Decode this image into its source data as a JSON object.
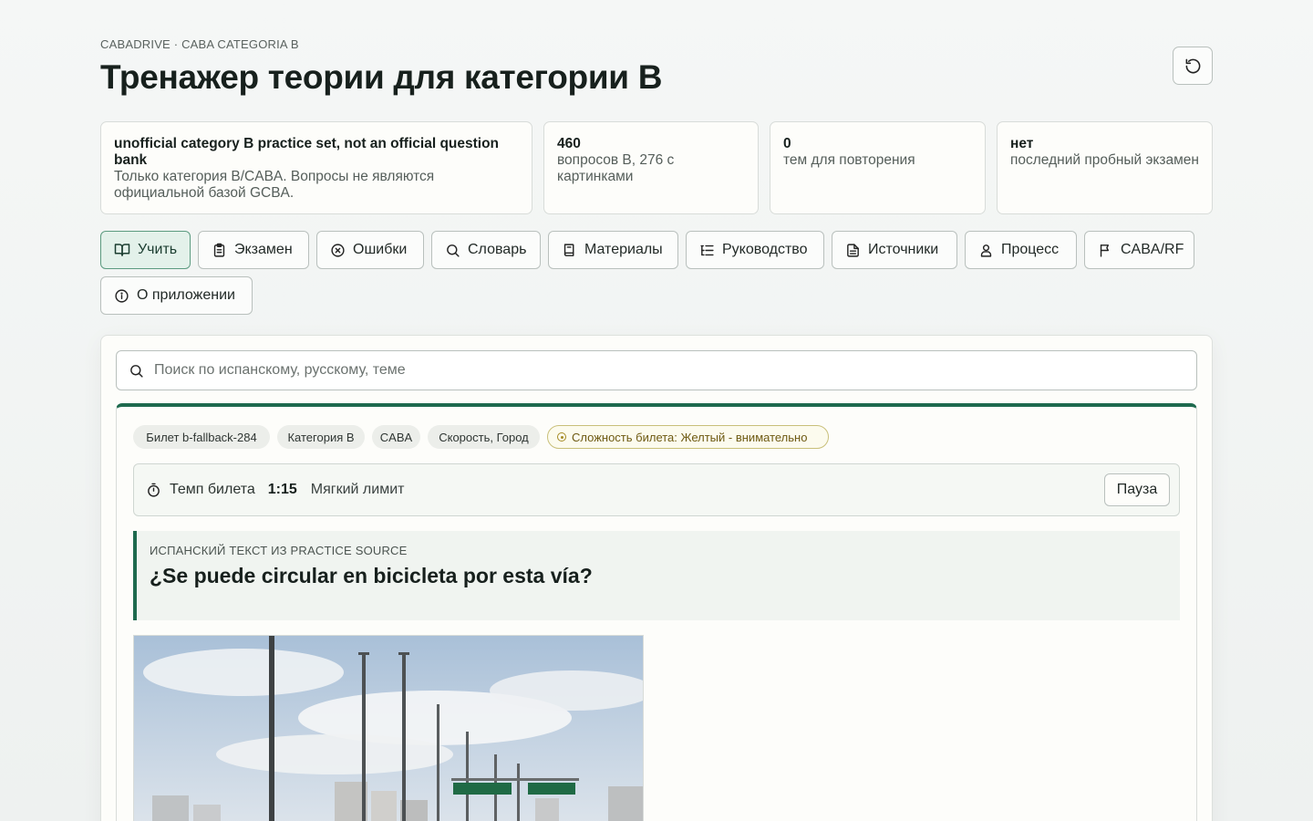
{
  "header": {
    "eyebrow": "CABADRIVE · CABA CATEGORIA B",
    "title": "Тренажер теории для категории B",
    "reset_icon": "rotate-ccw-icon"
  },
  "stats": [
    {
      "value": "unofficial category B practice set, not an official question bank",
      "label": "Только категория B/CABA. Вопросы не являются официальной базой GCBA."
    },
    {
      "value": "460",
      "label": "вопросов B, 276 с картинками"
    },
    {
      "value": "0",
      "label": "тем для повторения"
    },
    {
      "value": "нет",
      "label": "последний пробный экзамен"
    }
  ],
  "tabs": [
    {
      "label": "Учить",
      "icon": "book-open-icon",
      "active": true
    },
    {
      "label": "Экзамен",
      "icon": "clipboard-icon"
    },
    {
      "label": "Ошибки",
      "icon": "x-circle-icon"
    },
    {
      "label": "Словарь",
      "icon": "search-icon"
    },
    {
      "label": "Материалы",
      "icon": "book-icon"
    },
    {
      "label": "Руководство",
      "icon": "list-tree-icon"
    },
    {
      "label": "Источники",
      "icon": "file-text-icon"
    },
    {
      "label": "Процесс",
      "icon": "user-badge-icon"
    },
    {
      "label": "CABA/RF",
      "icon": "flag-icon"
    },
    {
      "label": "О приложении",
      "icon": "info-icon"
    }
  ],
  "search": {
    "placeholder": "Поиск по испанскому, русскому, теме",
    "icon": "search-icon"
  },
  "ticket": {
    "chips": [
      "Билет b-fallback-284",
      "Категория B",
      "CABA",
      "Скорость, Город"
    ],
    "difficulty": "Сложность билета: Желтый - внимательно",
    "timer_label": "Темп билета",
    "timer_value": "1:15",
    "timer_mode": "Мягкий лимит",
    "pause_label": "Пауза",
    "source_label": "ИСПАНСКИЙ ТЕКСТ ИЗ PRACTICE SOURCE",
    "question": "¿Se puede circular en bicicleta por esta vía?"
  },
  "colors": {
    "accent": "#1e6a4e",
    "active_tab_bg": "#e3f1ea",
    "warn_chip": "#c9c07a"
  }
}
